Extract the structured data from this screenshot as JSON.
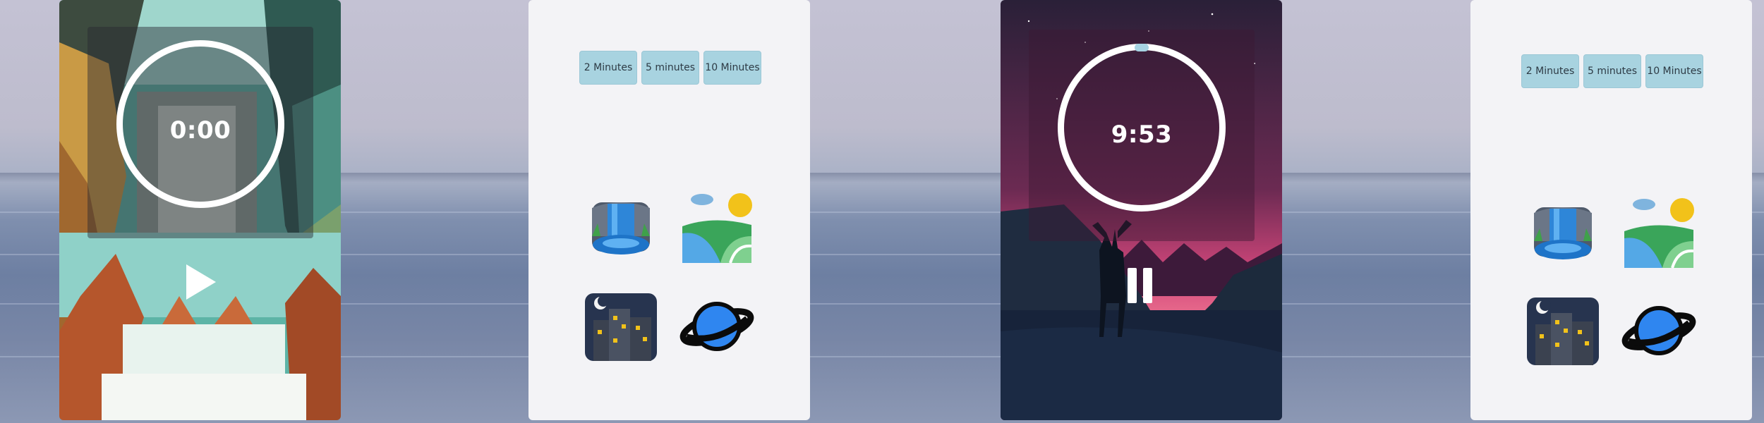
{
  "screens": [
    {
      "timer_display": "0:00",
      "state": "paused",
      "progress": 0
    },
    {
      "timer_display": "9:53",
      "state": "playing",
      "progress": 0.012
    }
  ],
  "duration_buttons": [
    {
      "labels": [
        "2 Minutes",
        "5 minutes",
        "10 Minutes"
      ]
    },
    {
      "labels": [
        "2 Minutes",
        "5 minutes",
        "10 Minutes"
      ]
    }
  ],
  "sounds": [
    "waterfall-icon",
    "landscape-icon",
    "night-city-icon",
    "planet-icon"
  ],
  "colors": {
    "button_bg": "#a8d3e0",
    "panel_bg": "#f3f3f6",
    "timer_text": "#ffffff"
  }
}
